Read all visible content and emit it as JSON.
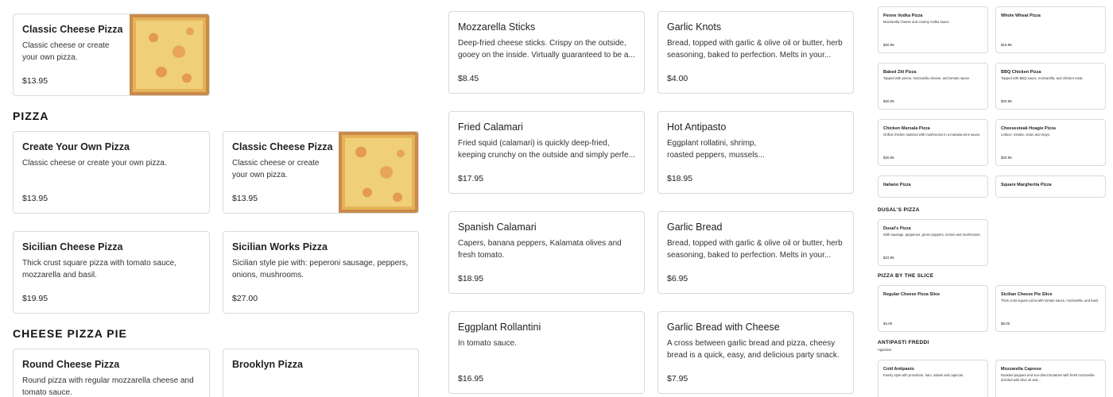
{
  "col1": {
    "top_card": {
      "title": "Classic Cheese Pizza",
      "desc": "Classic cheese or create your own pizza.",
      "price": "$13.95"
    },
    "section_pizza": "PIZZA",
    "pizza_items": [
      {
        "title": "Create Your Own Pizza",
        "desc": "Classic cheese or create your own pizza.",
        "price": "$13.95"
      },
      {
        "title": "Classic Cheese Pizza",
        "desc": "Classic cheese or create your own pizza.",
        "price": "$13.95"
      },
      {
        "title": "Sicilian Cheese Pizza",
        "desc": "Thick crust square pizza with tomato sauce, mozzarella and basil.",
        "price": "$19.95"
      },
      {
        "title": "Sicilian Works Pizza",
        "desc": "Sicilian style pie with: peperoni sausage, peppers, onions, mushrooms.",
        "price": "$27.00"
      }
    ],
    "section_cheese_pie": "CHEESE PIZZA PIE",
    "pie_items": [
      {
        "title": "Round Cheese Pizza",
        "desc": "Round pizza with regular mozzarella cheese and tomato sauce."
      },
      {
        "title": "Brooklyn Pizza"
      }
    ]
  },
  "col2": {
    "items": [
      {
        "title": "Mozzarella Sticks",
        "desc": "Deep-fried cheese sticks. Crispy on the outside, gooey on the inside. Virtually guaranteed to be a...",
        "price": "$8.45"
      },
      {
        "title": "Garlic Knots",
        "desc": "Bread, topped with garlic & olive oil or butter, herb seasoning, baked to perfection. Melts in your...",
        "price": "$4.00"
      },
      {
        "title": "Fried Calamari",
        "desc": "Fried squid (calamari) is quickly deep-fried, keeping crunchy on the outside and simply perfe...",
        "price": "$17.95"
      },
      {
        "title": "Hot Antipasto",
        "desc": "Eggplant rollatini, shrimp, roasted peppers, mussels...",
        "price": "$18.95"
      },
      {
        "title": "Spanish Calamari",
        "desc": "Capers, banana peppers, Kalamata olives and fresh tomato.",
        "price": "$18.95"
      },
      {
        "title": "Garlic Bread",
        "desc": "Bread, topped with garlic & olive oil or butter, herb seasoning, baked to perfection. Melts in your...",
        "price": "$6.95"
      },
      {
        "title": "Eggplant Rollantini",
        "desc": "In tomato sauce.",
        "price": "$16.95"
      },
      {
        "title": "Garlic Bread with Cheese",
        "desc": "A cross between garlic bread and pizza, cheesy bread is a quick, easy, and delicious party snack.",
        "price": "$7.95"
      }
    ]
  },
  "col3": {
    "items": [
      {
        "title": "Penne Vodka Pizza",
        "desc": "Mozzarella cheese and creamy vodka sauce.",
        "price": "$20.95"
      },
      {
        "title": "Whole Wheat Pizza",
        "desc": "",
        "price": "$18.95"
      },
      {
        "title": "Baked Ziti Pizza",
        "desc": "Topped with penne, mozzarella cheese, and tomato sauce.",
        "price": "$20.95"
      },
      {
        "title": "BBQ Chicken Pizza",
        "desc": "Topped with BBQ sauce, mozzarella, and chicken meat.",
        "price": "$20.95"
      },
      {
        "title": "Chicken Marsala Pizza",
        "desc": "Grilled chicken sautéed with mushrooms in a marsala wine sauce.",
        "price": "$20.95"
      },
      {
        "title": "Cheesesteak Hoagie Pizza",
        "desc": "Lettuce, tomato, onion and mayo.",
        "price": "$20.95"
      },
      {
        "title": "Italiano Pizza",
        "desc": "",
        "price": ""
      },
      {
        "title": "Square Margherita Pizza",
        "desc": "",
        "price": ""
      }
    ],
    "section_dusal": "DUSAL'S PIZZA",
    "dusal_item": {
      "title": "Dusal's Pizza",
      "desc": "With sausage, pepperoni, green peppers, onions and mushrooms.",
      "price": "$22.95"
    },
    "section_slice": "PIZZA BY THE SLICE",
    "slice_items": [
      {
        "title": "Regular Cheese Pizza Slice",
        "desc": "",
        "price": "$4.00"
      },
      {
        "title": "Sicilian Cheese Pie Slice",
        "desc": "Thick crust square pizza with tomato sauce, mozzarella, and basil.",
        "price": "$5.00"
      }
    ],
    "section_antipasti": "ANTIPASTI FREDDI",
    "antipasti_sub": "Appetizer.",
    "antipasti_items": [
      {
        "title": "Cold Antipasto",
        "desc": "Family style with provolone, ham, salami and capicola."
      },
      {
        "title": "Mozzarella Caprese",
        "desc": "Roasted peppers and sun-dried tomatoes with fresh mozzarella drizzled with olive oil and..."
      }
    ]
  },
  "colors": {
    "border": "#d9d9d9",
    "pizza_sauce": "#e8a45a",
    "pizza_cheese": "#f3d488"
  }
}
